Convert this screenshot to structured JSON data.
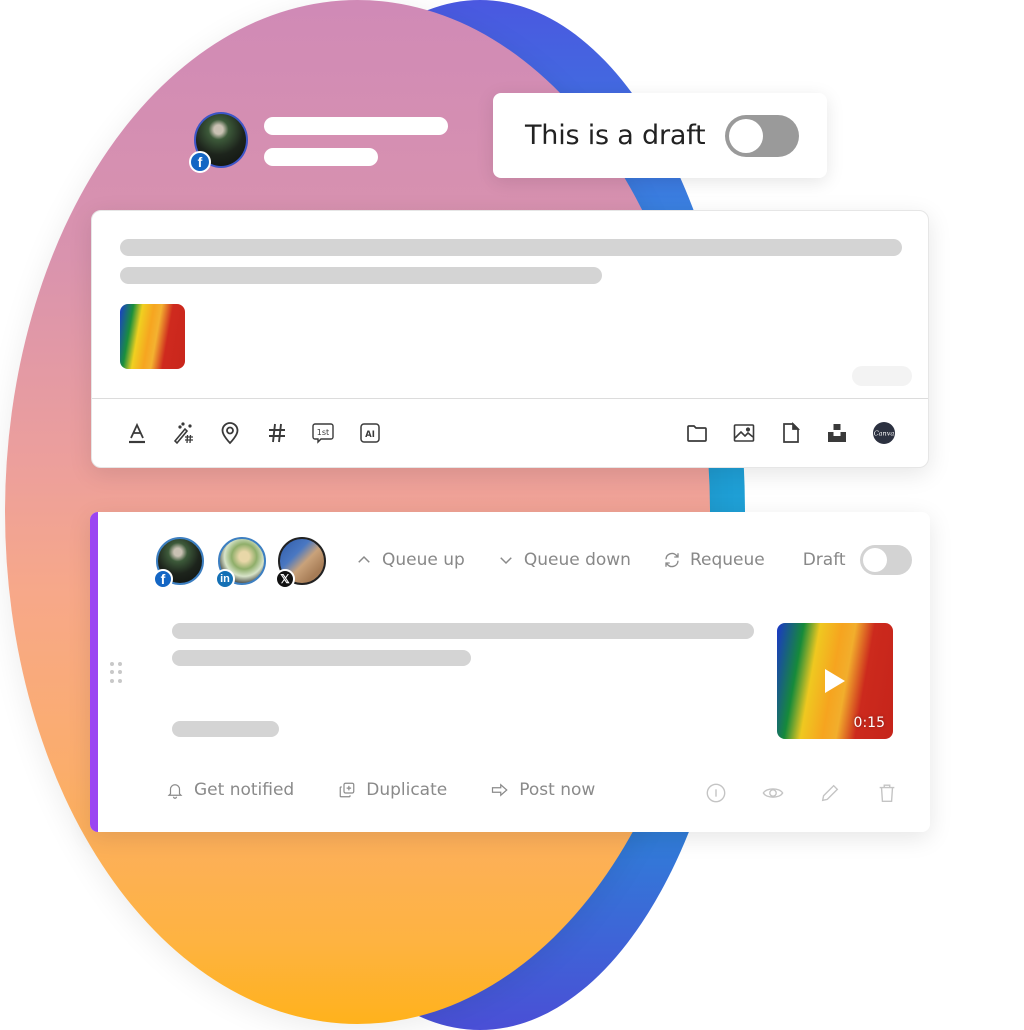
{
  "header": {
    "account": {
      "network": "facebook",
      "avatar_icon": "user-avatar-icon"
    }
  },
  "draft_card": {
    "label": "This is a draft",
    "toggle_on": false
  },
  "composer": {
    "attachment": "image-thumbnail",
    "toolbar_left": [
      {
        "name": "text-format-icon",
        "title": "Text format"
      },
      {
        "name": "magic-hashtag-icon",
        "title": "Hashtag suggestions"
      },
      {
        "name": "location-pin-icon",
        "title": "Location"
      },
      {
        "name": "hashtag-icon",
        "title": "Hashtags"
      },
      {
        "name": "first-comment-icon",
        "title": "First comment",
        "glyph": "1st"
      },
      {
        "name": "ai-assistant-icon",
        "title": "AI assistant",
        "glyph": "AI"
      }
    ],
    "toolbar_right": [
      {
        "name": "folder-icon",
        "title": "Media library"
      },
      {
        "name": "image-icon",
        "title": "Add image"
      },
      {
        "name": "document-icon",
        "title": "Add document"
      },
      {
        "name": "unsplash-icon",
        "title": "Unsplash"
      },
      {
        "name": "canva-icon",
        "title": "Canva",
        "glyph": "Canva"
      }
    ]
  },
  "queue_item": {
    "accent_color": "#9b45f2",
    "accounts": [
      {
        "network": "facebook",
        "badge": "f"
      },
      {
        "network": "linkedin",
        "badge": "in"
      },
      {
        "network": "x",
        "badge": "𝕏"
      }
    ],
    "actions": {
      "queue_up": "Queue up",
      "queue_down": "Queue down",
      "requeue": "Requeue",
      "draft_label": "Draft",
      "draft_toggle_on": false
    },
    "video": {
      "duration": "0:15"
    },
    "footer": {
      "get_notified": "Get notified",
      "duplicate": "Duplicate",
      "post_now": "Post now"
    },
    "footer_icons": [
      "info-icon",
      "preview-eye-icon",
      "edit-pencil-icon",
      "trash-icon"
    ]
  }
}
